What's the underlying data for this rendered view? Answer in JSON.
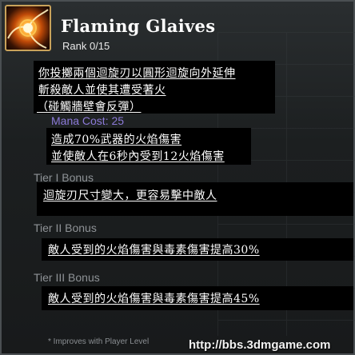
{
  "skill": {
    "title": "Flaming Glaives",
    "rank": "Rank 0/15",
    "icon": "flaming-glaives-icon"
  },
  "description": {
    "line1": "你投擲兩個迴旋刃以圓形迴旋向外延伸",
    "line2": "斬殺敵人並使其遭受著火",
    "line3": "（碰觸牆壁會反彈）"
  },
  "mana_cost": "Mana Cost: 25",
  "damage": {
    "line1": "造成70%武器的火焰傷害",
    "line2": "並使敵人在6秒內受到12火焰傷害"
  },
  "tiers": [
    {
      "label": "Tier I Bonus",
      "text": "迴旋刃尺寸變大，更容易擊中敵人"
    },
    {
      "label": "Tier II Bonus",
      "text": "敵人受到的火焰傷害與毒素傷害提高30%"
    },
    {
      "label": "Tier III Bonus",
      "text": "敵人受到的火焰傷害與毒素傷害提高45%"
    }
  ],
  "footnote": "* Improves with Player Level",
  "watermark": "http://bbs.3dmgame.com",
  "colors": {
    "mana": "#8c7ad8",
    "tier_label": "#8e9296",
    "icon_border": "#c9a25a"
  }
}
